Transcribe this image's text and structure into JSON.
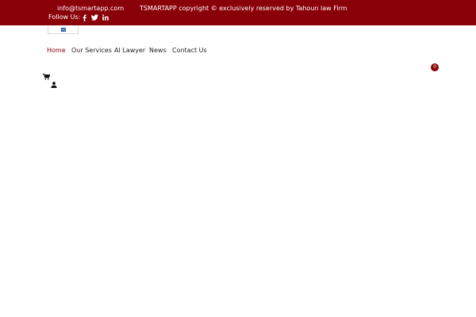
{
  "topbar": {
    "email": "info@tsmartapp.com",
    "copyright": "TSMARTAPP copyright © exclusively reserved by Tahoun law Firm",
    "follow_label": "Follow Us:",
    "social": [
      "facebook-icon",
      "twitter-icon",
      "linkedin-icon"
    ]
  },
  "nav": {
    "items": [
      {
        "label": "Home",
        "active": true
      },
      {
        "label": "Our Services",
        "active": false
      },
      {
        "label": "AI Lawyer",
        "active": false
      },
      {
        "label": "News",
        "active": false
      },
      {
        "label": "Contact Us",
        "active": false
      }
    ]
  },
  "cart": {
    "count": "0"
  },
  "colors": {
    "brand": "#8a0008",
    "text": "#222222",
    "background": "#ffffff"
  }
}
